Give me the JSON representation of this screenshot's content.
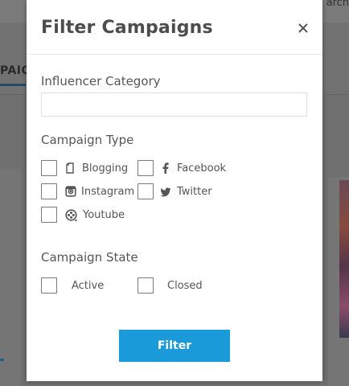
{
  "modal": {
    "title": "Filter Campaigns",
    "filter_button_label": "Filter"
  },
  "influencer_category": {
    "label": "Influencer Category",
    "value": "",
    "placeholder": ""
  },
  "campaign_type": {
    "label": "Campaign Type",
    "options": [
      {
        "label": "Blogging",
        "icon": "blog-icon",
        "checked": false
      },
      {
        "label": "Facebook",
        "icon": "facebook-icon",
        "checked": false
      },
      {
        "label": "Instagram",
        "icon": "instagram-icon",
        "checked": false
      },
      {
        "label": "Twitter",
        "icon": "twitter-icon",
        "checked": false
      },
      {
        "label": "Youtube",
        "icon": "youtube-icon",
        "checked": false
      }
    ]
  },
  "campaign_state": {
    "label": "Campaign State",
    "options": [
      {
        "label": "Active",
        "checked": false
      },
      {
        "label": "Closed",
        "checked": false
      }
    ]
  },
  "background": {
    "nav_partial_text": "PAIGI",
    "top_right_partial_text": "arch"
  },
  "colors": {
    "accent": "#1a9ad8",
    "title_text": "#4d4d4d",
    "label_text": "#555555",
    "overlay": "#6f6f6f"
  }
}
